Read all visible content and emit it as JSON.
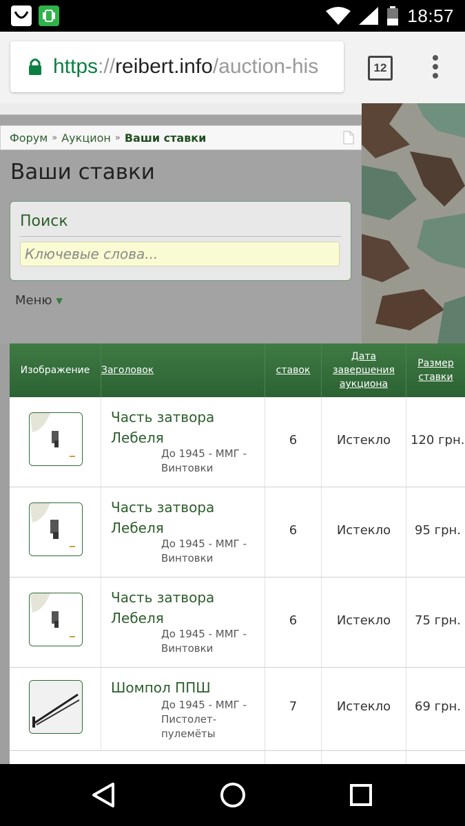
{
  "status_bar": {
    "time": "18:57",
    "icons": [
      "notification-bag-icon",
      "phone-sync-icon",
      "wifi-icon",
      "signal-icon",
      "battery-icon"
    ]
  },
  "browser": {
    "url_scheme": "https",
    "url_sep": "://",
    "url_host": "reibert.info",
    "url_path": "/auction-his",
    "tab_count": "12"
  },
  "breadcrumb": {
    "items": [
      "Форум",
      "Аукцион"
    ],
    "current": "Ваши ставки"
  },
  "page": {
    "title": "Ваши ставки"
  },
  "search": {
    "label": "Поиск",
    "placeholder": "Ключевые слова..."
  },
  "menu": {
    "label": "Меню"
  },
  "table": {
    "headers": {
      "image": "Изображение",
      "title": "Заголовок",
      "bids": "ставок",
      "end_date": "Дата завершения аукциона",
      "bid_size": "Размер ставки"
    },
    "rows": [
      {
        "title": "Часть затвора Лебеля",
        "category": "До 1945 - ММГ - Винтовки",
        "bids": "6",
        "status": "Истекло",
        "amount": "120 грн."
      },
      {
        "title": "Часть затвора Лебеля",
        "category": "До 1945 - ММГ - Винтовки",
        "bids": "6",
        "status": "Истекло",
        "amount": "95 грн."
      },
      {
        "title": "Часть затвора Лебеля",
        "category": "До 1945 - ММГ - Винтовки",
        "bids": "6",
        "status": "Истекло",
        "amount": "75 грн."
      },
      {
        "title": "Шомпол ППШ",
        "category": "До 1945 - ММГ - Пистолет-пулемёты",
        "bids": "7",
        "status": "Истекло",
        "amount": "69 грн."
      }
    ]
  },
  "colors": {
    "header_green": "#2c6233",
    "link_green": "#2b5d2b"
  }
}
